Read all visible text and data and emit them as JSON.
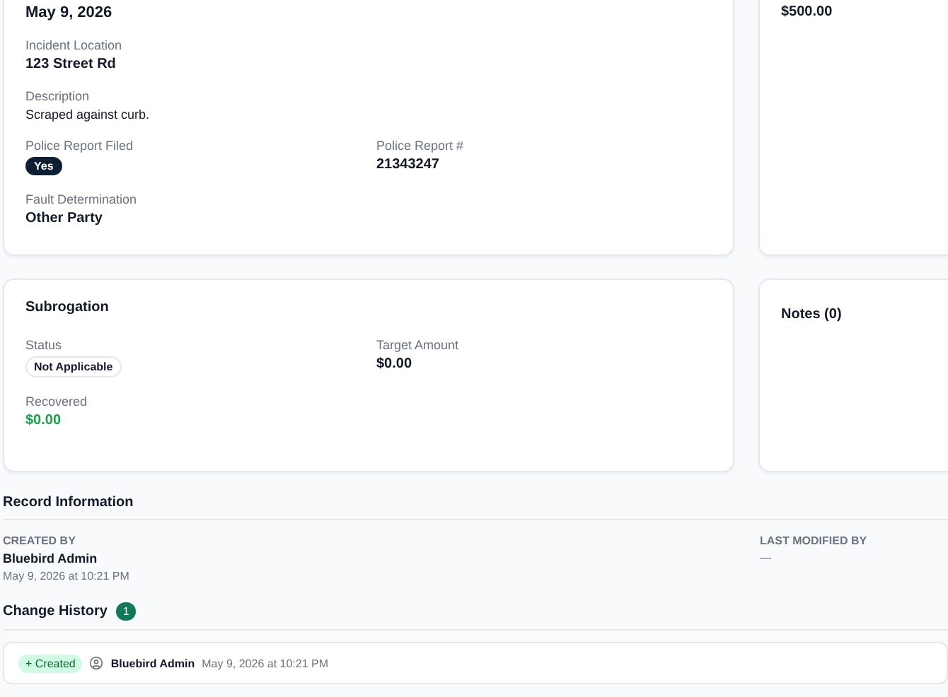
{
  "incident_card": {
    "top_value": "May 9, 2026",
    "fields": [
      {
        "label": "Incident Location",
        "value": "123 Street Rd",
        "kind": "text"
      },
      {
        "label": "Description",
        "value": "Scraped against curb.",
        "kind": "plain"
      },
      {
        "label": "Police Report Filed",
        "value": "Yes",
        "kind": "badge"
      },
      {
        "label": "Police Report #",
        "value": "21343247",
        "kind": "text"
      },
      {
        "label": "Fault Determination",
        "value": "Other Party",
        "kind": "text"
      }
    ]
  },
  "side_card": {
    "top_value": "$500.00"
  },
  "subrogation": {
    "title": "Subrogation",
    "fields": [
      {
        "label": "Status",
        "value": "Not Applicable",
        "kind": "pill"
      },
      {
        "label": "Target Amount",
        "value": "$0.00",
        "kind": "text"
      },
      {
        "label": "Recovered",
        "value": "$0.00",
        "kind": "money"
      }
    ]
  },
  "notes": {
    "title": "Notes (0)"
  },
  "record_information": {
    "title": "Record Information",
    "created_by": {
      "label": "CREATED BY",
      "name": "Bluebird Admin",
      "date": "May 9, 2026 at 10:21 PM"
    },
    "last_modified_by": {
      "label": "LAST MODIFIED BY",
      "value": "—"
    }
  },
  "change_history": {
    "title": "Change History",
    "count": "1",
    "entries": [
      {
        "action": "+ Created",
        "user": "Bluebird Admin",
        "date": "May 9, 2026 at 10:21 PM"
      }
    ]
  }
}
